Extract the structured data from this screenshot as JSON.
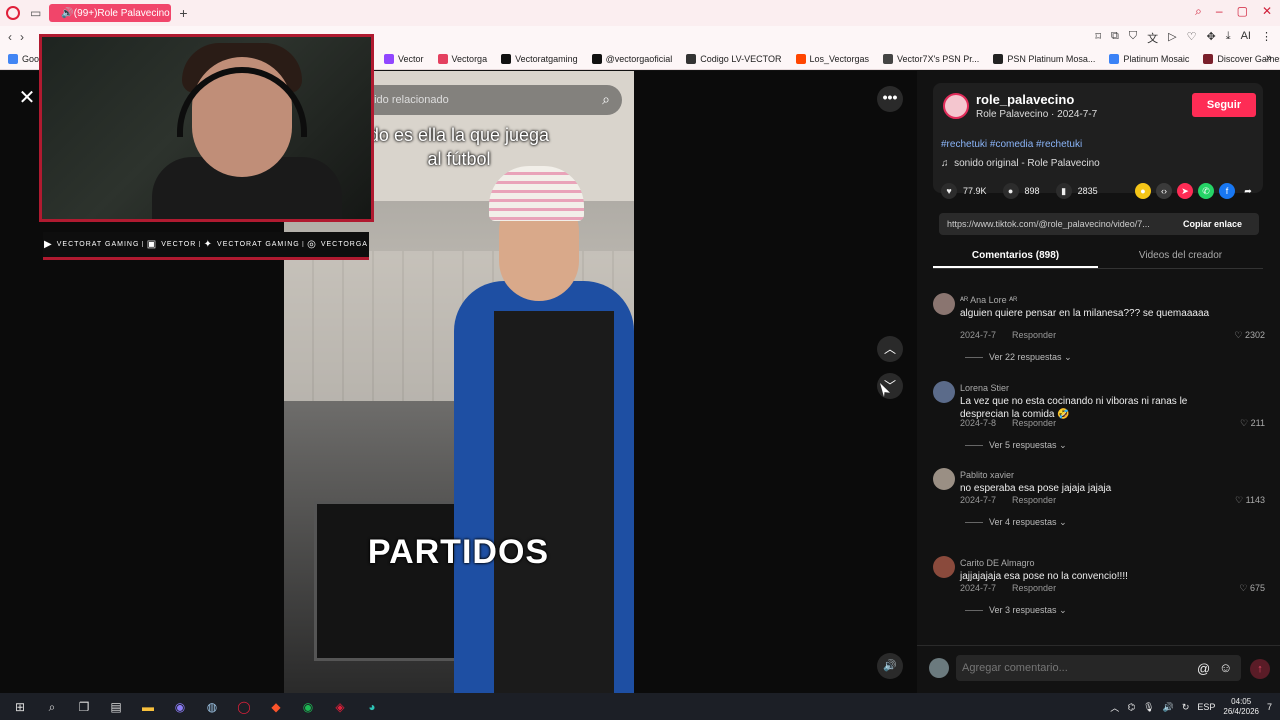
{
  "browser": {
    "tab_title": "(99+)Role Palavecino",
    "new_tab": "+",
    "bookmark_first": "Goog",
    "bookmarks": [
      {
        "label": "Vector",
        "color": "#9146ff"
      },
      {
        "label": "Vectorga",
        "color": "#e4405f"
      },
      {
        "label": "Vectoratgaming",
        "color": "#111111"
      },
      {
        "label": "@vectorgaoficial",
        "color": "#111111"
      },
      {
        "label": "Codigo LV-VECTOR",
        "color": "#333333"
      },
      {
        "label": "Los_Vectorgas",
        "color": "#ff4500"
      },
      {
        "label": "Vector7X's PSN Pr...",
        "color": "#444444"
      },
      {
        "label": "PSN Platinum Mosa...",
        "color": "#222222"
      },
      {
        "label": "Platinum Mosaic",
        "color": "#3b82f6"
      },
      {
        "label": "Discover Games -...",
        "color": "#7a1f2b"
      }
    ]
  },
  "video": {
    "search_placeholder": "nido relacionado",
    "caption_top_line1": "do es ella la que juega",
    "caption_top_line2": "al fútbol",
    "caption_bottom": "PARTIDOS"
  },
  "overlay": {
    "socials": [
      {
        "icon": "youtube-icon",
        "glyph": "▶",
        "label": "VECTORAT GAMING"
      },
      {
        "icon": "twitch-icon",
        "glyph": "▣",
        "label": "VECTOR"
      },
      {
        "icon": "twitter-icon",
        "glyph": "✦",
        "label": "VECTORAT GAMING"
      },
      {
        "icon": "instagram-icon",
        "glyph": "◎",
        "label": "VECTORGA"
      }
    ]
  },
  "creator": {
    "handle": "role_palavecino",
    "name": "Role Palavecino",
    "date": "2024-7-7",
    "follow": "Seguir",
    "hashtags": "#rechetuki #comedia #rechetuki",
    "music": "sonido original - Role Palavecino",
    "likes": "77.9K",
    "comments_count": "898",
    "saves": "2835",
    "link": "https://www.tiktok.com/@role_palavecino/video/7...",
    "copy_link": "Copiar enlace"
  },
  "tabs": {
    "comments": "Comentarios (898)",
    "creator_videos": "Videos del creador"
  },
  "comments": [
    {
      "user": "ᴬᴿ Ana Lore ᴬᴿ",
      "text": "alguien quiere pensar en la milanesa??? se quemaaaaa",
      "date": "2024-7-7",
      "reply": "Responder",
      "likes": "2302",
      "more": "Ver 22 respuestas",
      "avatar": "#8a7570"
    },
    {
      "user": "Lorena Stier",
      "text": "La vez que no esta cocinando ni viboras ni ranas le desprecian la comida 🤣",
      "date": "2024-7-8",
      "reply": "Responder",
      "likes": "211",
      "more": "Ver 5 respuestas",
      "avatar": "#5b6b8a"
    },
    {
      "user": "Pablito xavier",
      "text": "no esperaba esa pose jajaja jajaja",
      "date": "2024-7-7",
      "reply": "Responder",
      "likes": "1143",
      "more": "Ver 4 respuestas",
      "avatar": "#9a8f84"
    },
    {
      "user": "Carito DE Almagro",
      "text": "jajjajajaja esa pose no la convencio!!!!",
      "date": "2024-7-7",
      "reply": "Responder",
      "likes": "675",
      "more": "Ver 3 respuestas",
      "avatar": "#8a4a3c"
    }
  ],
  "comment_bar": {
    "placeholder": "Agregar comentario..."
  },
  "taskbar": {
    "lang": "ESP",
    "time": "04:05",
    "date": "26/4/2026",
    "notif": "7"
  }
}
